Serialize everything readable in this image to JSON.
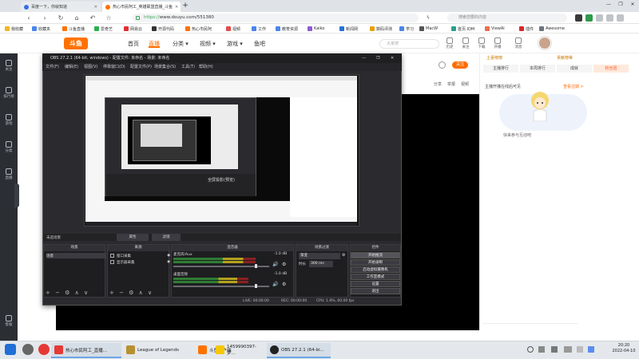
{
  "browser": {
    "tabs": [
      {
        "title": "百度一下，你就知道",
        "color": "#3a6ee8",
        "active": false
      },
      {
        "title": "热心市民阿工_英雄联盟直播_斗鱼",
        "color": "#ff7200",
        "active": true
      }
    ],
    "new_tab": "+",
    "window_controls": [
      "—",
      "❐",
      "✕"
    ],
    "nav": {
      "back": "‹",
      "forward": "›",
      "reload": "↻",
      "home": "⌂",
      "undo": "↶",
      "star": "☆"
    },
    "address_scheme": "https://",
    "address_rest": "www.douyu.com/551380",
    "search_placeholder": "搜索您要的内容",
    "bookmarks": [
      "我收藏",
      "收藏夹",
      "斗鱼直播",
      "爱奇艺",
      "网易云",
      "开源代码",
      "热心市民阿",
      "视频",
      "工作",
      "教育资源",
      "Kaiko",
      "新闻网",
      "数码评测",
      "学习",
      "MacW",
      "首页·IDM",
      "ViewAl",
      "插件",
      "Awesome"
    ]
  },
  "douyu": {
    "logo": "斗鱼",
    "nav": [
      "首页",
      "直播",
      "分类 ▾",
      "视频 ▾",
      "游戏 ▾",
      "鱼吧"
    ],
    "nav_active": 1,
    "search_placeholder": "大家搜",
    "header_icons": [
      "历史",
      "关注",
      "下载",
      "开播",
      "消息"
    ],
    "follow_button": "关注",
    "stream_actions": [
      "分享",
      "举报",
      "视频"
    ],
    "sidebar": [
      "关注",
      "排行榜",
      "游戏",
      "分类",
      "直播",
      "客服"
    ],
    "right_panel": {
      "tabs": [
        "主播排行",
        "本周排行",
        "成就",
        "粉丝团"
      ],
      "top_links": [
        "土豪榜榜",
        "贡献榜等"
      ],
      "notice": "主播开播在线后可见",
      "notice_link": "查看往期 >",
      "caption": "快来参与互动吧"
    }
  },
  "obs": {
    "title": "OBS 27.2.1 (64-bit, windows) - 配置文件: 未命名 - 场景: 未命名",
    "menu": [
      "文件(F)",
      "编辑(E)",
      "视图(V)",
      "停靠窗口(D)",
      "配置文件(P)",
      "场景集合(S)",
      "工具(T)",
      "帮助(H)"
    ],
    "nested_projector": "全屏投影(预览)",
    "scene_bar": [
      "未选场景",
      "属性",
      "滤镜"
    ],
    "docks": {
      "scenes": {
        "title": "场景",
        "items": [
          "场景"
        ]
      },
      "sources": {
        "title": "来源",
        "items": [
          "窗口采集",
          "显示器采集"
        ]
      },
      "mixer": {
        "title": "混音器",
        "channels": [
          {
            "name": "麦克风/Aux",
            "db": "-1.0 dB",
            "level": 0.86
          },
          {
            "name": "桌面音频",
            "db": "-1.0 dB",
            "level": 0.78
          }
        ]
      },
      "transitions": {
        "title": "场景过渡",
        "type": "渐变",
        "duration_label": "时长",
        "duration": "300 ms"
      },
      "controls": {
        "title": "控件",
        "buttons": [
          "开始推流",
          "开始录制",
          "启动虚拟摄像机",
          "工作室模式",
          "设置",
          "退出"
        ]
      }
    },
    "dock_footer": "+ − ⚙ ∧ ∨",
    "status": [
      "LIVE: 00:00:00",
      "REC: 00:00:00",
      "CPU: 1.9%, 60.00 fps"
    ]
  },
  "taskbar": {
    "apps": [
      "热心市民阿工_直播...",
      "League of Legends",
      "斗鱼客户端",
      "1459990397-梦...",
      "OBS 27.2.1 (64-bi..."
    ],
    "time": "20:20",
    "date": "2022-04-10"
  }
}
